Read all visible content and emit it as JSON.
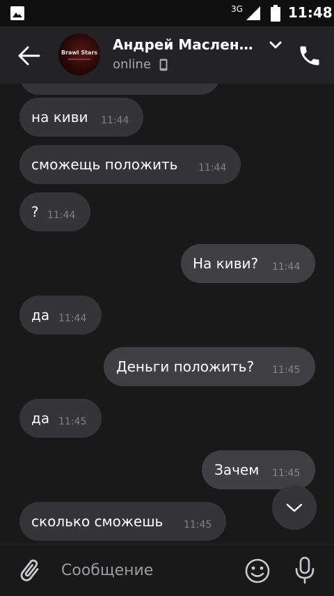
{
  "status_bar": {
    "network": "3G",
    "time": "11:48",
    "icons": [
      "gallery-icon",
      "signal-icon",
      "battery-icon"
    ]
  },
  "header": {
    "contact_name": "Андрей Масленикова",
    "status": "online",
    "avatar_text": "Brawl Stars",
    "icons": [
      "back-arrow-icon",
      "chevron-down-icon",
      "phone-icon",
      "mobile-device-icon"
    ]
  },
  "messages": [
    {
      "text": "на киви",
      "time": "11:44",
      "direction": "in"
    },
    {
      "text": "сможещь положить",
      "time": "11:44",
      "direction": "in"
    },
    {
      "text": "?",
      "time": "11:44",
      "direction": "in"
    },
    {
      "text": "На киви?",
      "time": "11:44",
      "direction": "out"
    },
    {
      "text": "да",
      "time": "11:44",
      "direction": "in"
    },
    {
      "text": "Деньги положить?",
      "time": "11:45",
      "direction": "out"
    },
    {
      "text": "да",
      "time": "11:45",
      "direction": "in"
    },
    {
      "text": "Зачем",
      "time": "11:45",
      "direction": "out"
    },
    {
      "text": "сколько сможешь",
      "time": "11:45",
      "direction": "in"
    }
  ],
  "input": {
    "placeholder": "Сообщение",
    "icons": [
      "paperclip-icon",
      "emoji-icon",
      "microphone-icon"
    ]
  },
  "colors": {
    "background": "#19191a",
    "header": "#232325",
    "bubble_in": "#353537",
    "bubble_out": "#404043",
    "time_text": "#818184"
  }
}
